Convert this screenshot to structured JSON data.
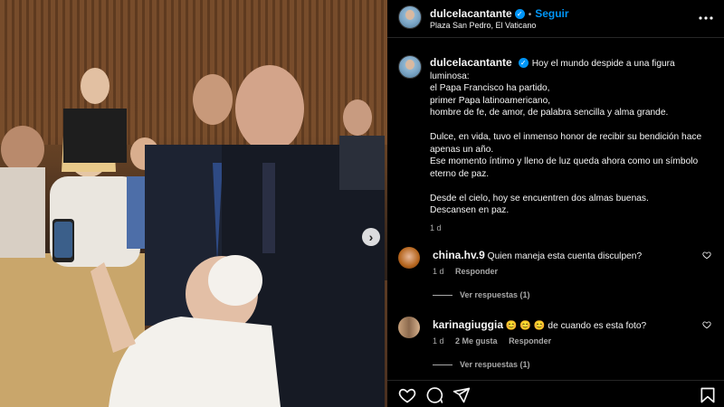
{
  "post": {
    "author": "dulcelacantante",
    "verified": true,
    "follow_label": "Seguir",
    "location": "Plaza San Pedro, El Vaticano",
    "more_icon": "more-options-icon",
    "caption": "Hoy el mundo despide a una figura luminosa:\nel Papa Francisco ha partido,\nprimer Papa latinoamericano,\nhombre de fe, de amor, de palabra sencilla y alma grande.\n\nDulce, en vida, tuvo el inmenso honor de recibir su bendición hace apenas un año.\nEse momento íntimo y lleno de luz queda ahora como un símbolo eterno de paz.\n\nDesde el cielo, hoy se encuentren dos almas buenas.\nDescansen en paz.",
    "caption_time": "1 d"
  },
  "comments": [
    {
      "user": "china.hv.9",
      "text": "Quien maneja esta cuenta disculpen?",
      "time": "1 d",
      "reply_label": "Responder",
      "likes": "",
      "view_replies": "Ver respuestas (1)"
    },
    {
      "user": "karinagiuggia",
      "text": "😊 😊 😊 de cuando es esta foto?",
      "time": "1 d",
      "likes": "2 Me gusta",
      "reply_label": "Responder",
      "view_replies": "Ver respuestas (1)"
    }
  ],
  "actions": [
    "heart-icon",
    "comment-icon",
    "share-icon",
    "save-icon"
  ],
  "carousel": {
    "next_icon": "chevron-right-icon",
    "next_glyph": "›"
  },
  "colors": {
    "accent": "#0095f6",
    "background": "#000000",
    "secondary_text": "#a8a8a8"
  }
}
